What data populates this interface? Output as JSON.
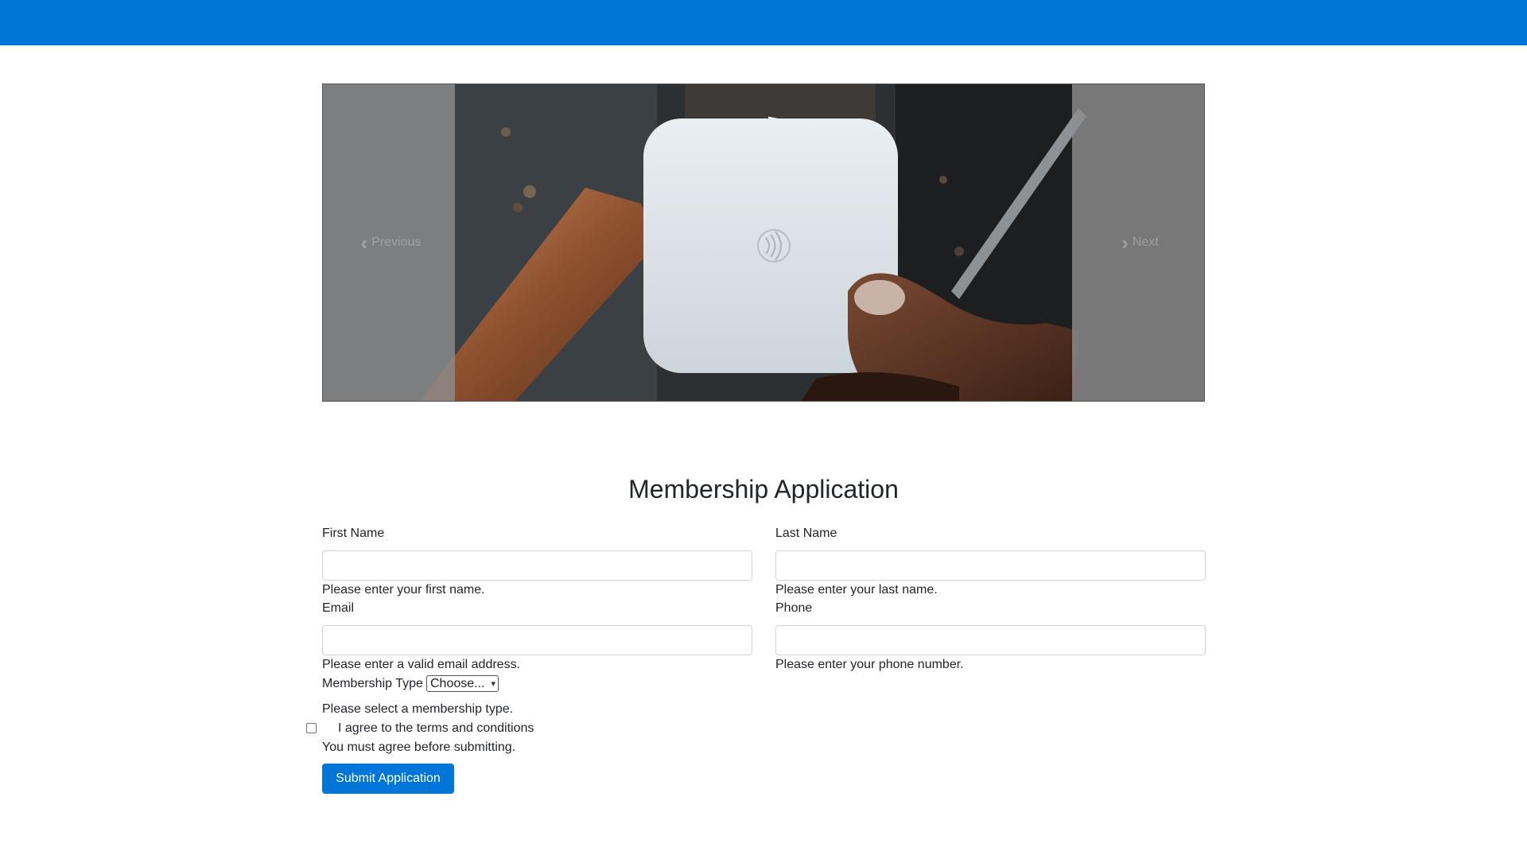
{
  "header": {
    "color": "#0275d8"
  },
  "carousel": {
    "prev_label": "Previous",
    "next_label": "Next",
    "prev_icon": "chevron-left-icon",
    "next_icon": "chevron-right-icon"
  },
  "form": {
    "title": "Membership Application",
    "first_name": {
      "label": "First Name",
      "value": "",
      "hint": "Please enter your first name."
    },
    "last_name": {
      "label": "Last Name",
      "value": "",
      "hint": "Please enter your last name."
    },
    "email": {
      "label": "Email",
      "value": "",
      "hint": "Please enter a valid email address."
    },
    "phone": {
      "label": "Phone",
      "value": "",
      "hint": "Please enter your phone number."
    },
    "membership": {
      "label": "Membership Type",
      "selected": "Choose...",
      "hint": "Please select a membership type."
    },
    "terms": {
      "label": "I agree to the terms and conditions",
      "checked": false,
      "hint": "You must agree before submitting."
    },
    "submit_label": "Submit Application",
    "accent": "#0275d8"
  }
}
